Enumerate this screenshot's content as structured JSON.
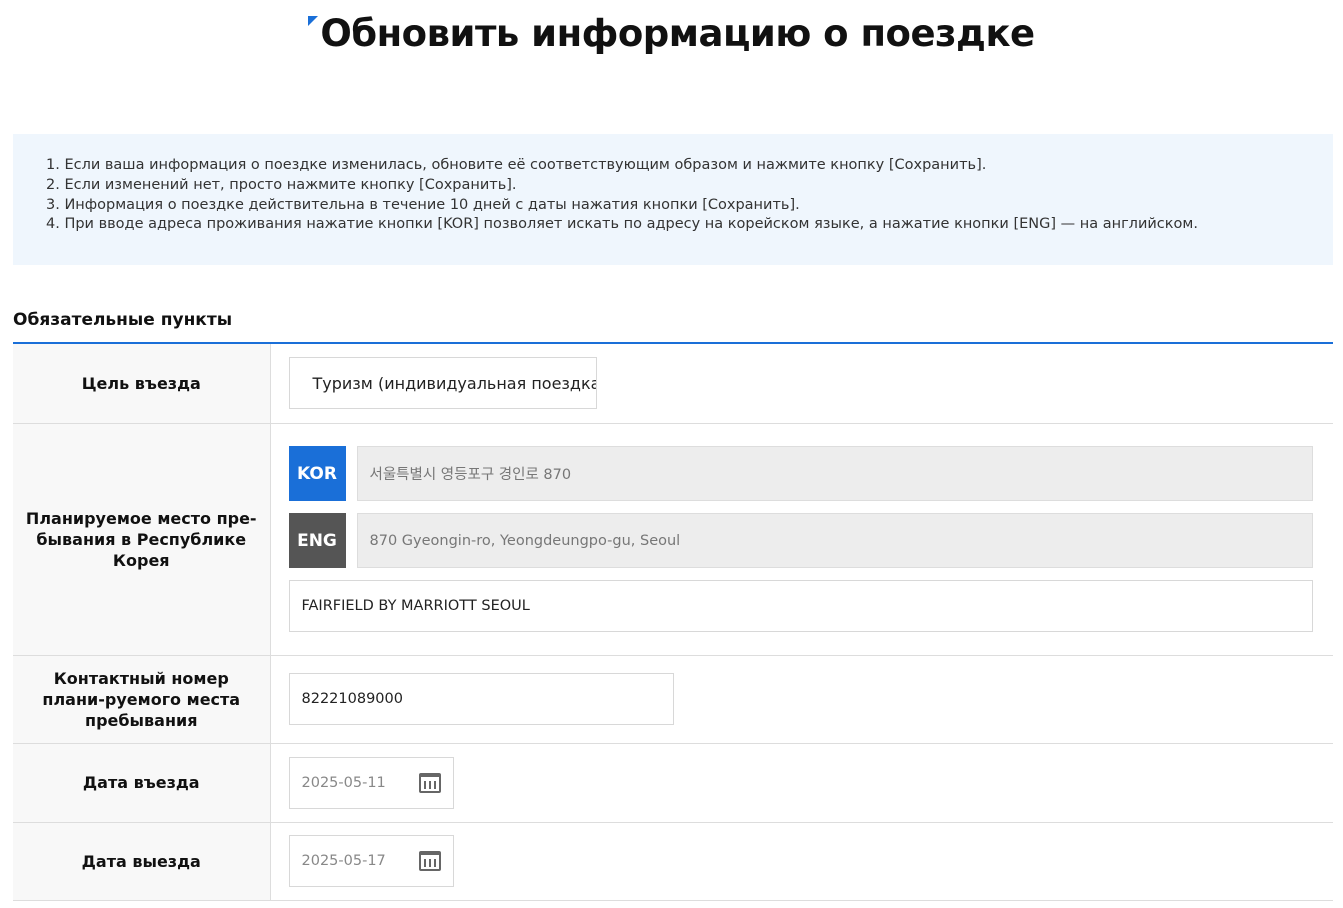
{
  "title": "Обновить информацию о поездке",
  "notice": [
    "1. Если ваша информация о поездке изменилась, обновите её соответствующим образом и нажмите кнопку [Сохранить].",
    "2. Если изменений нет, просто нажмите кнопку [Сохранить].",
    "3. Информация о поездке действительна в течение 10 дней с даты нажатия кнопки [Сохранить].",
    "4. При вводе адреса проживания нажатие кнопки [KOR] позволяет искать по адресу на корейском языке, а нажатие кнопки [ENG] — на английском."
  ],
  "section_title": "Обязательные пункты",
  "fields": {
    "purpose": {
      "label": "Цель въезда",
      "value": "Туризм (индивидуальная поездка)"
    },
    "address": {
      "label": "Планируемое место пре-бывания в Республике Корея",
      "kor_button": "KOR",
      "eng_button": "ENG",
      "kor_value": "서울특별시 영등포구 경인로 870",
      "eng_value": "870 Gyeongin-ro, Yeongdeungpo-gu, Seoul",
      "detail_value": "FAIRFIELD BY MARRIOTT SEOUL"
    },
    "phone": {
      "label": "Контактный номер плани-руемого места пребывания",
      "value": "82221089000"
    },
    "entry": {
      "label": "Дата въезда",
      "value": "2025-05-11"
    },
    "exit": {
      "label": "Дата выезда",
      "value": "2025-05-17"
    }
  },
  "colors": {
    "accent": "#1a6fd8",
    "eng": "#555555"
  }
}
